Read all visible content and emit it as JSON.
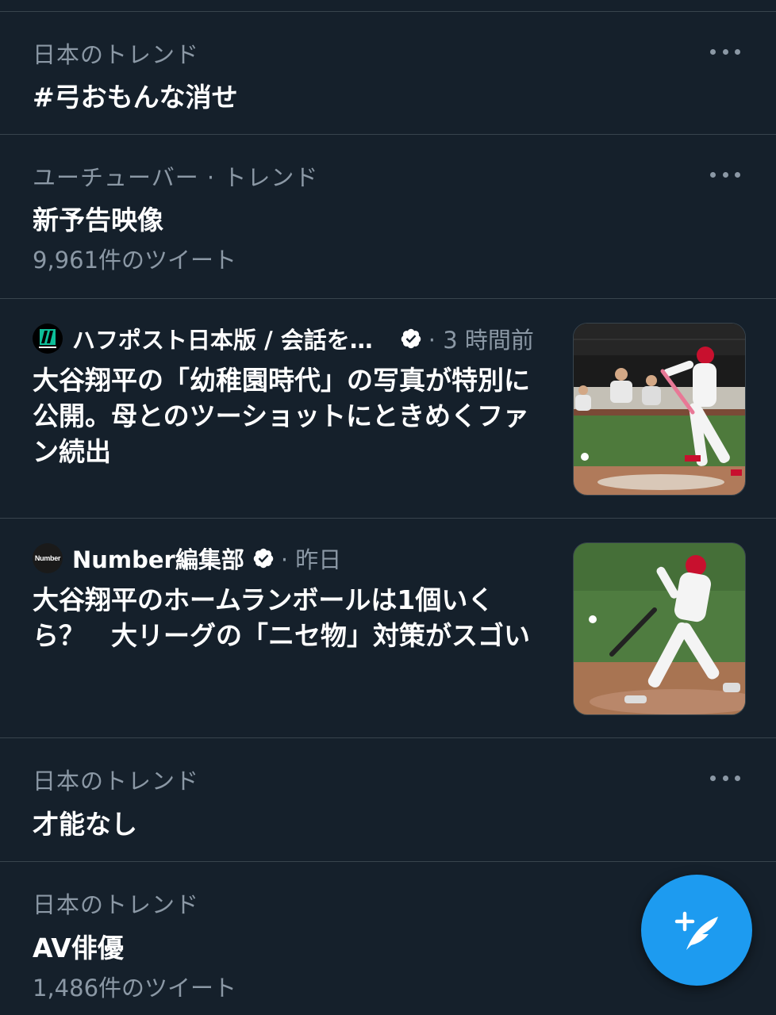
{
  "trends": [
    {
      "context": "日本のトレンド",
      "title": "#弓おもんな消せ"
    },
    {
      "context": "ユーチューバー · トレンド",
      "title": "新予告映像",
      "count": "9,961件のツイート"
    },
    {
      "context": "日本のトレンド",
      "title": "才能なし"
    },
    {
      "context": "日本のトレンド",
      "title": "AV俳優",
      "count": "1,486件のツイート"
    }
  ],
  "news": [
    {
      "source": "ハフポスト日本版 / 会話を…",
      "source_logo_text": "HUFFPOST",
      "time": "· 3 時間前",
      "headline": "大谷翔平の「幼稚園時代」の写真が特別に公開。母とのツーショットにときめくファン続出",
      "image_icon": "baseball-batter-photo"
    },
    {
      "source": "Number編集部",
      "source_logo_text": "Number",
      "time": "· 昨日",
      "headline": "大谷翔平のホームランボールは1個いくら？　大リーグの「ニセ物」対策がスゴい",
      "image_icon": "baseball-batter-photo"
    }
  ],
  "colors": {
    "background": "#15202b",
    "muted": "#8b98a5",
    "divider": "#38444d",
    "accent": "#1d9bf0",
    "huffpost_green": "#0dbe98"
  },
  "fab": {
    "icon": "compose-tweet-icon"
  }
}
